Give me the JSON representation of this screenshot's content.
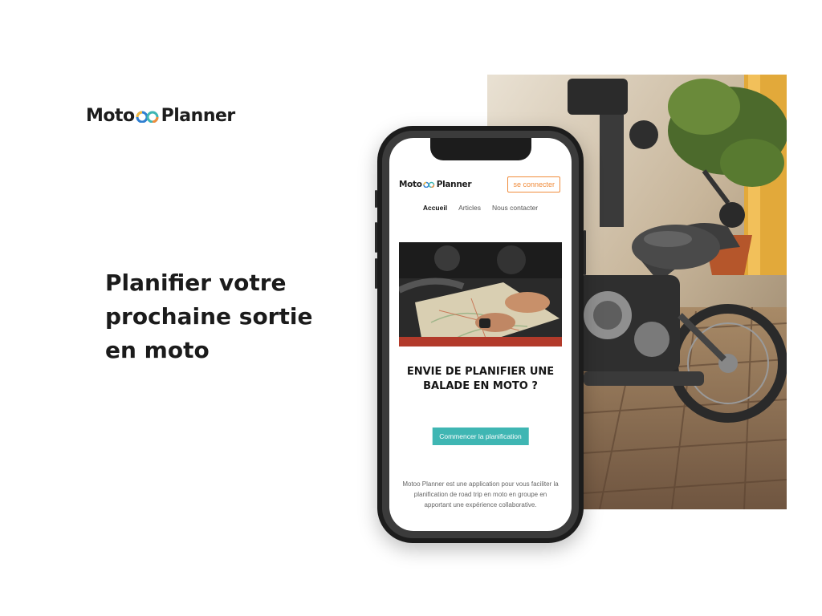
{
  "brand": {
    "name_start": "Moto",
    "name_end": "Planner",
    "logo_icon": "double-circle-logo-icon"
  },
  "tagline": "Planifier votre prochaine sortie en moto",
  "photo": {
    "subject": "motorcycle-photo"
  },
  "phone": {
    "header": {
      "brand_start": "Moto",
      "brand_end": "Planner",
      "login_label": "se connecter"
    },
    "nav": {
      "home": "Accueil",
      "articles": "Articles",
      "contact": "Nous contacter"
    },
    "hero_image": "map-and-hands-photo",
    "title": "ENVIE DE PLANIFIER UNE BALADE EN MOTO ?",
    "cta_label": "Commencer la planification",
    "description": "Motoo Planner est une application pour vous faciliter la planification de road trip en moto en groupe en apportant une expérience collaborative."
  },
  "colors": {
    "accent_orange": "#f08c3c",
    "accent_teal": "#3fb6b3",
    "logo_blue": "#2f7fd1",
    "text_dark": "#1d1d1d"
  }
}
